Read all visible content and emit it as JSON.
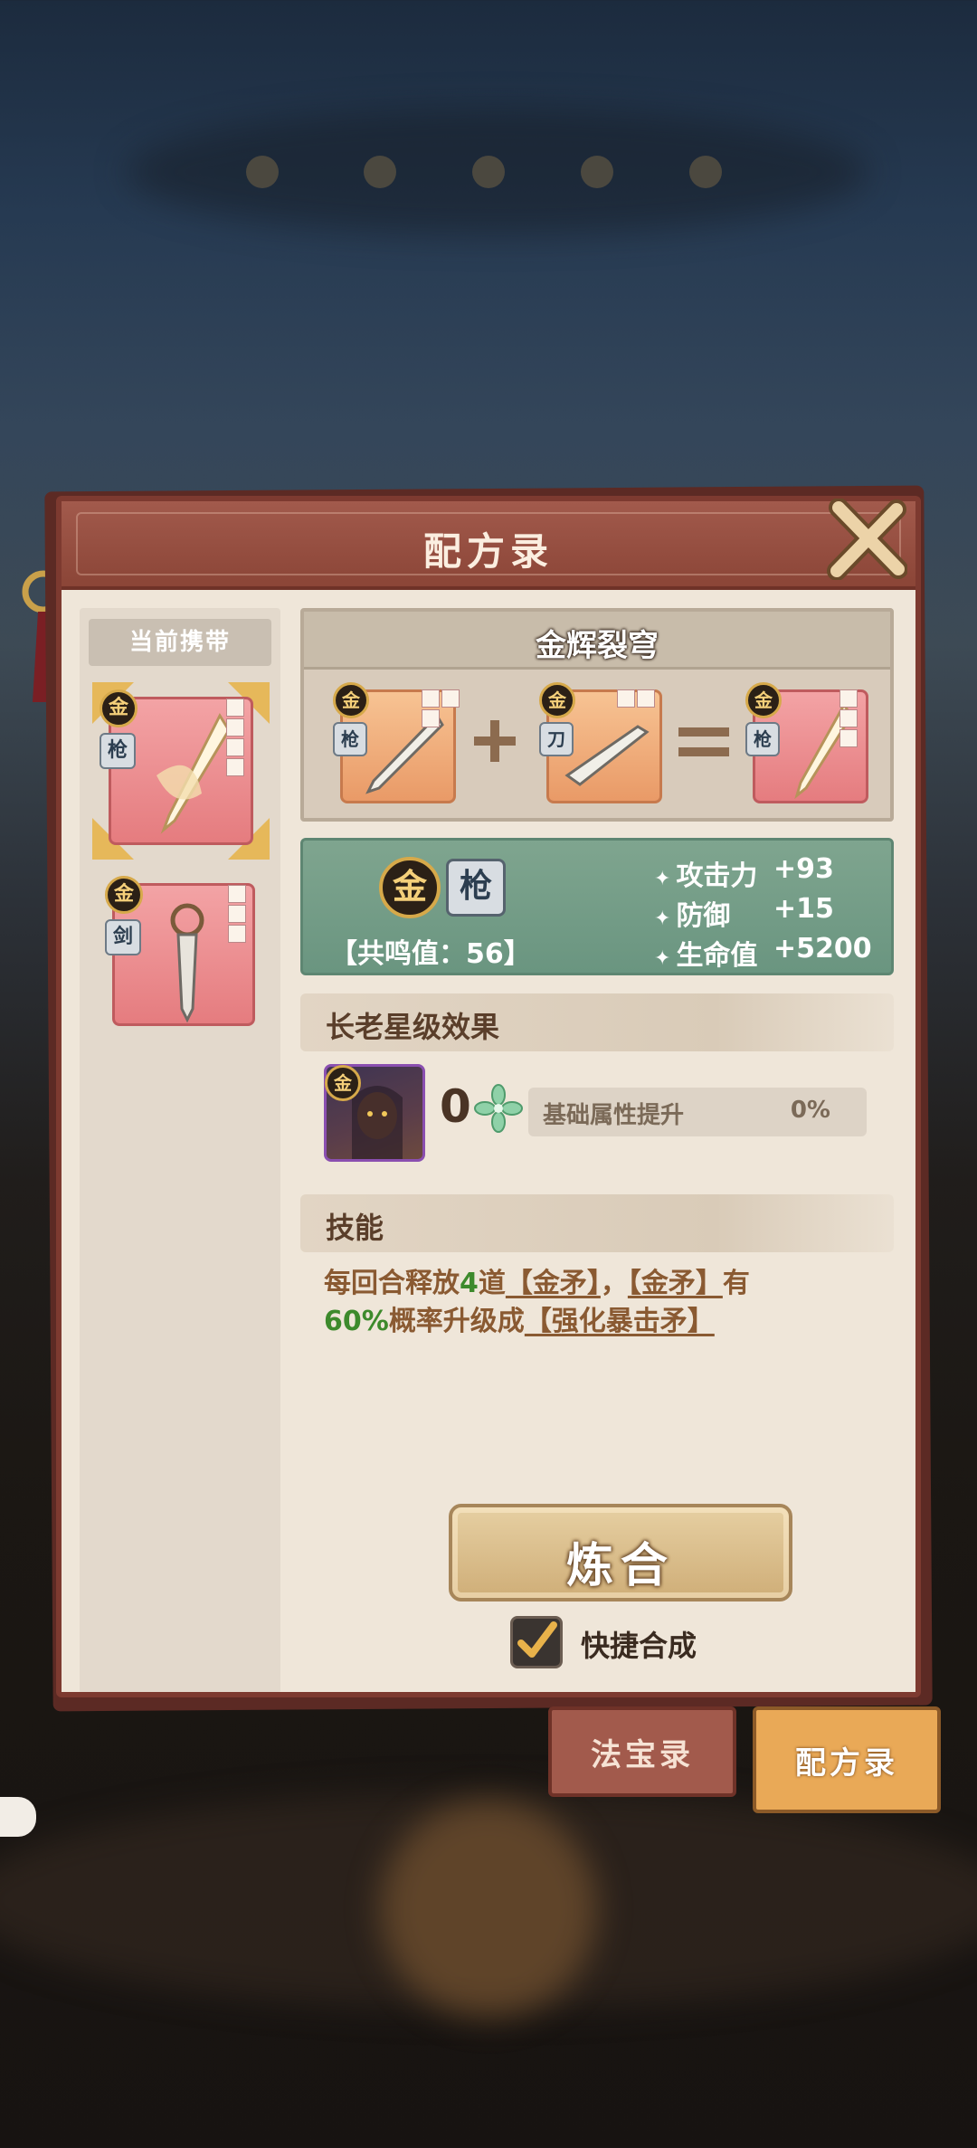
{
  "panel": {
    "title": "配方录"
  },
  "left": {
    "carry_label": "当前携带",
    "items": [
      {
        "grade": "金",
        "type": "枪"
      },
      {
        "grade": "金",
        "type": "剑"
      }
    ]
  },
  "recipe": {
    "name": "金辉裂穹",
    "inputs": [
      {
        "grade": "金",
        "type": "枪"
      },
      {
        "grade": "金",
        "type": "刀"
      }
    ],
    "output": {
      "grade": "金",
      "type": "枪"
    }
  },
  "stats": {
    "grade": "金",
    "type": "枪",
    "resonance": "【共鸣值：56】",
    "lines": [
      {
        "label": "攻击力",
        "value": "+93"
      },
      {
        "label": "防御",
        "value": "+15"
      },
      {
        "label": "生命值",
        "value": "+5200"
      }
    ]
  },
  "elder": {
    "section_title": "长老星级效果",
    "grade": "金",
    "star_count": "0",
    "attr_label": "基础属性提升",
    "attr_value": "0%"
  },
  "skill": {
    "section_title": "技能",
    "t1": "每回合释放",
    "t2": "4",
    "t3": "道",
    "t4": "【金矛】",
    "t5": "，",
    "t6": "【金矛】",
    "t7": "有",
    "t8": "60%",
    "t9": "概率升级成",
    "t10": "【强化暴击矛】"
  },
  "actions": {
    "refine_label": "炼合",
    "quick_label": "快捷合成",
    "quick_checked": true
  },
  "tabs": [
    {
      "label": "法宝录",
      "active": false
    },
    {
      "label": "配方录",
      "active": true
    }
  ],
  "colors": {
    "panel_bg": "#efe6d9",
    "header": "#a25a4c",
    "stats_green": "#7fa58f",
    "gold_badge": "#d6a94a",
    "highlight_green": "#3d8a2c"
  }
}
